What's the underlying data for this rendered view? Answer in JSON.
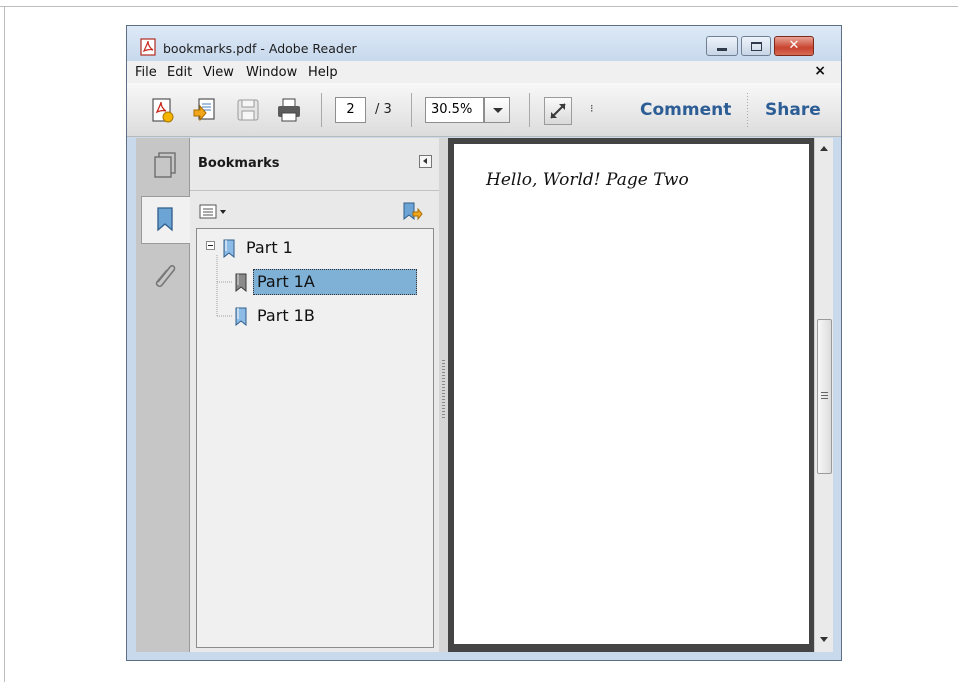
{
  "window": {
    "title": "bookmarks.pdf - Adobe Reader",
    "close_symbol": "✕"
  },
  "menu": {
    "items": [
      "File",
      "Edit",
      "View",
      "Window",
      "Help"
    ],
    "close_doc": "×"
  },
  "toolbar": {
    "icons": [
      "create-pdf-icon",
      "export-icon",
      "save-icon",
      "print-icon",
      "fit-page-icon"
    ],
    "page_number": "2",
    "page_total": "/ 3",
    "zoom": "30.5%",
    "more": "⁝",
    "comment_label": "Comment",
    "share_label": "Share"
  },
  "nav_panel": {
    "tabs": [
      "pages-icon",
      "bookmarks-icon",
      "attachments-icon"
    ],
    "active_tab": "bookmarks-icon"
  },
  "bookmarks": {
    "header": "Bookmarks",
    "items": [
      {
        "label": "Part 1",
        "level": 0,
        "expanded": true
      },
      {
        "label": "Part 1A",
        "level": 1,
        "selected": true
      },
      {
        "label": "Part 1B",
        "level": 1
      }
    ]
  },
  "document": {
    "text": "Hello, World! Page Two"
  },
  "colors": {
    "accent_text": "#2d5d95",
    "selection": "#7fb0d6",
    "doc_background": "#444444"
  }
}
